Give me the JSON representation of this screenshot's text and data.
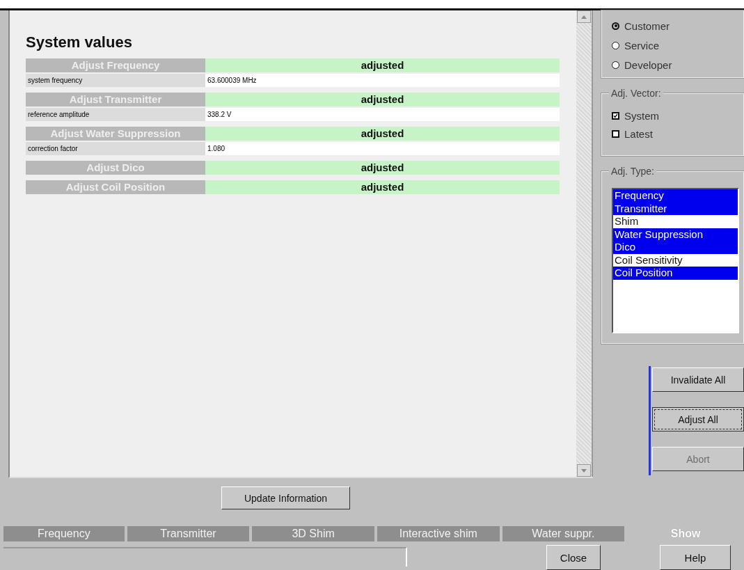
{
  "content": {
    "title": "System values",
    "sections": [
      {
        "name": "Adjust Frequency",
        "status": "adjusted",
        "param": {
          "label": "system frequency",
          "value": "63.600039 MHz"
        }
      },
      {
        "name": "Adjust Transmitter",
        "status": "adjusted",
        "param": {
          "label": "reference amplitude",
          "value": "338.2 V"
        }
      },
      {
        "name": "Adjust Water Suppression",
        "status": "adjusted",
        "param": {
          "label": "correction factor",
          "value": "1.080"
        }
      },
      {
        "name": "Adjust Dico",
        "status": "adjusted"
      },
      {
        "name": "Adjust Coil Position",
        "status": "adjusted"
      }
    ]
  },
  "update_button": "Update Information",
  "user_mode": [
    {
      "label": "Customer",
      "selected": true
    },
    {
      "label": "Service",
      "selected": false
    },
    {
      "label": "Developer",
      "selected": false
    }
  ],
  "adj_vector": {
    "title": "Adj. Vector:",
    "options": [
      {
        "label": "System",
        "checked": true
      },
      {
        "label": "Latest",
        "checked": false
      }
    ]
  },
  "adj_type": {
    "title": "Adj. Type:",
    "items": [
      {
        "label": "Frequency",
        "selected": true
      },
      {
        "label": "Transmitter",
        "selected": true
      },
      {
        "label": "Shim",
        "selected": false
      },
      {
        "label": "Water Suppression",
        "selected": true
      },
      {
        "label": "Dico",
        "selected": true
      },
      {
        "label": "Coil Sensitivity",
        "selected": false
      },
      {
        "label": "Coil Position",
        "selected": true
      }
    ]
  },
  "actions": [
    {
      "label": "Invalidate All",
      "focused": false,
      "disabled": false
    },
    {
      "label": "Adjust All",
      "focused": true,
      "disabled": false
    },
    {
      "label": "Abort",
      "focused": false,
      "disabled": true
    }
  ],
  "tabs": [
    {
      "label": "Frequency",
      "selected": false
    },
    {
      "label": "Transmitter",
      "selected": false
    },
    {
      "label": "3D Shim",
      "selected": false
    },
    {
      "label": "Interactive shim",
      "selected": false
    },
    {
      "label": "Water suppr.",
      "selected": false
    },
    {
      "label": "Show",
      "selected": true
    }
  ],
  "buttons": [
    "Close",
    "Help"
  ]
}
